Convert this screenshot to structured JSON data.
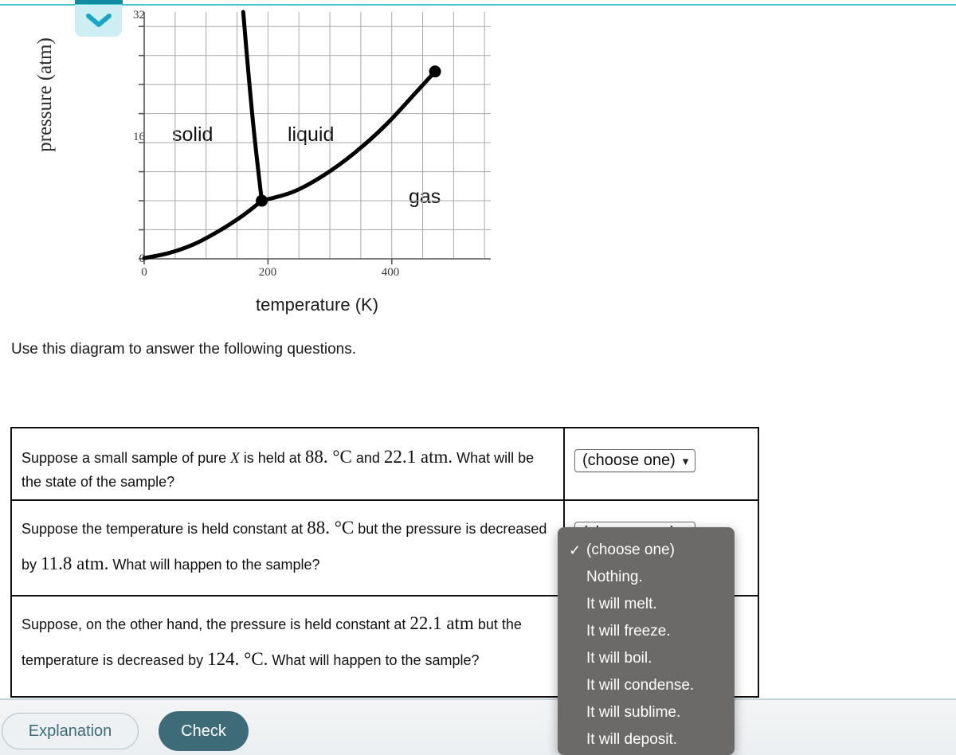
{
  "top_bar": {
    "collapse_icon": "chevron-down-icon",
    "accent_color": "#49c3d4",
    "tab_color": "#0f8ca0"
  },
  "chart_data": {
    "type": "line",
    "title": "",
    "xlabel": "temperature (K)",
    "ylabel": "pressure (atm)",
    "xlim": [
      0,
      560
    ],
    "ylim": [
      0,
      34
    ],
    "xticks": [
      0,
      200,
      400
    ],
    "yticks": [
      0,
      16,
      32
    ],
    "xtick_labels": [
      "0",
      "200",
      "400"
    ],
    "ytick_labels": [
      "0",
      "16",
      "32"
    ],
    "grid": true,
    "grid_x_step": 50,
    "grid_y_step": 4,
    "region_labels": [
      {
        "text": "solid",
        "x": 100,
        "y": 16
      },
      {
        "text": "liquid",
        "x": 290,
        "y": 16
      },
      {
        "text": "gas",
        "x": 475,
        "y": 8.5
      }
    ],
    "series": [
      {
        "name": "sublimation-curve",
        "points": [
          [
            0,
            0.1
          ],
          [
            40,
            0.8
          ],
          [
            80,
            2.0
          ],
          [
            120,
            3.8
          ],
          [
            160,
            6.0
          ],
          [
            190,
            8.0
          ]
        ]
      },
      {
        "name": "fusion-curve",
        "points": [
          [
            190,
            8.0
          ],
          [
            178,
            17
          ],
          [
            168,
            26
          ],
          [
            160,
            34
          ]
        ]
      },
      {
        "name": "vaporization-curve",
        "points": [
          [
            190,
            8.0
          ],
          [
            240,
            9.2
          ],
          [
            290,
            11.5
          ],
          [
            340,
            14.6
          ],
          [
            390,
            18.4
          ],
          [
            440,
            23.0
          ],
          [
            470,
            25.8
          ]
        ]
      }
    ],
    "markers": [
      {
        "name": "triple-point",
        "x": 190,
        "y": 8.0
      },
      {
        "name": "critical-point",
        "x": 470,
        "y": 25.8
      }
    ]
  },
  "prompt": "Use this diagram to answer the following questions.",
  "questions": [
    {
      "parts": [
        {
          "t": "Suppose a small sample of pure ",
          "style": "plain"
        },
        {
          "t": "X",
          "style": "var"
        },
        {
          "t": " is held at ",
          "style": "plain"
        },
        {
          "t": "88. °C",
          "style": "num"
        },
        {
          "t": " and ",
          "style": "plain"
        },
        {
          "t": "22.1 atm.",
          "style": "num"
        },
        {
          "t": " What will be the state of the sample?",
          "style": "plain"
        }
      ],
      "select_value": "(choose one)",
      "select_open": false
    },
    {
      "parts": [
        {
          "t": "Suppose the temperature is held constant at ",
          "style": "plain"
        },
        {
          "t": "88. °C",
          "style": "num"
        },
        {
          "t": " but the pressure is decreased by ",
          "style": "plain"
        },
        {
          "t": "11.8 atm.",
          "style": "num"
        },
        {
          "t": " What will happen to the sample?",
          "style": "plain"
        }
      ],
      "select_value": "(choose one)",
      "select_open": true
    },
    {
      "parts": [
        {
          "t": "Suppose, on the other hand, the pressure is held constant at ",
          "style": "plain"
        },
        {
          "t": "22.1 atm",
          "style": "num"
        },
        {
          "t": " but the temperature is decreased by ",
          "style": "plain"
        },
        {
          "t": "124. °C.",
          "style": "num"
        },
        {
          "t": " What will happen to the sample?",
          "style": "plain"
        }
      ],
      "select_value": "(choose one)",
      "select_open": false
    }
  ],
  "dropdown": {
    "selected": "(choose one)",
    "options": [
      "(choose one)",
      "Nothing.",
      "It will melt.",
      "It will freeze.",
      "It will boil.",
      "It will condense.",
      "It will sublime.",
      "It will deposit."
    ],
    "background_color": "#6b6a68",
    "text_color": "#ffffff"
  },
  "footer": {
    "explanation_label": "Explanation",
    "check_label": "Check",
    "check_color": "#3d6b78"
  }
}
